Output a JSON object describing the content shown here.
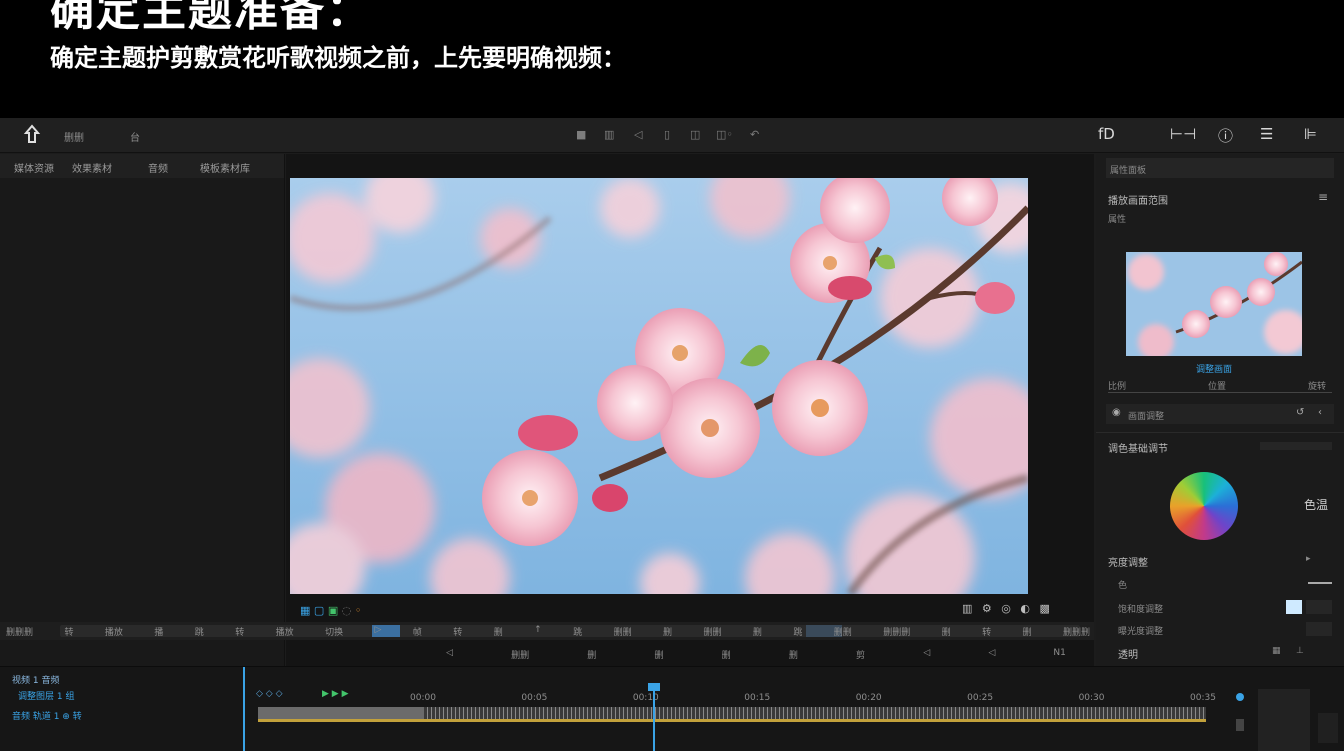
{
  "caption": {
    "headline": "确定主题准备：",
    "subline": "确定主题护剪敷赏花听歌视频之前，上先要明确视频："
  },
  "editor": {
    "menubar": {
      "app_icon": "home-icon",
      "items": [
        "删删",
        "台"
      ],
      "center_tools": [
        "■",
        "▥",
        "◁",
        "▯",
        "◫",
        "◫◦",
        "↶"
      ],
      "right_icons": [
        "fd-icon",
        "split-icon",
        "info-icon",
        "sliders-icon",
        "panel-icon"
      ]
    },
    "left_panel": {
      "tabs": [
        "媒体资源",
        "效果素材",
        "音频",
        "模板素材库"
      ]
    },
    "viewer": {
      "left_controls": [
        "▦",
        "▢",
        "▣",
        "◌",
        "◦"
      ],
      "right_controls": [
        "▥",
        "⚙",
        "◎",
        "◐",
        "▩"
      ],
      "scrub_rows": {
        "row1": [
          "删删删",
          "转",
          "播放",
          "播",
          "跳",
          "转",
          "播放",
          "切换",
          "▷",
          "帧",
          "转",
          "删",
          "↑",
          "跳",
          "删删",
          "删",
          "删删",
          "删",
          "跳",
          "删删",
          "删删删",
          "删",
          "转",
          "删",
          "删删删"
        ],
        "row2": [
          "◁",
          "删删",
          "删",
          "删",
          "删",
          "删",
          "剪",
          "◁",
          "◁",
          "N1"
        ]
      }
    },
    "right_panel": {
      "header_tab": "属性面板",
      "section_title": "播放画面范围",
      "section_sub": "属性",
      "thumb_caption": "调整画面",
      "slider_labels": [
        "比例",
        "位置",
        "旋转"
      ],
      "adjust_row_label": "画面调整",
      "color_title": "调色基础调节",
      "color_side_label": "色温",
      "props": [
        {
          "label": "亮度调整",
          "value": ""
        },
        {
          "label": "色",
          "value": ""
        },
        {
          "label": "饱和度调整",
          "value": ""
        },
        {
          "label": "曝光度调整",
          "value": ""
        },
        {
          "label": "透明",
          "value": ""
        }
      ]
    },
    "timeline": {
      "track_rows": [
        "视频 1 音频",
        "调整图层 1 组",
        "音频 轨道 1 ⊕ 转"
      ],
      "markers": [
        "◇ ◇ ◇",
        "▶ ▶ ▶"
      ],
      "ruler_labels": [
        "00:00",
        "00:05",
        "00:10",
        "00:15",
        "00:20",
        "00:25",
        "00:30",
        "00:35"
      ],
      "playhead_label": "00:10"
    }
  },
  "colors": {
    "accent": "#3aa3e6",
    "green_accent": "#43c46b",
    "panel_bg": "#1c1c1c",
    "clip_yellow": "#c2a13b"
  }
}
